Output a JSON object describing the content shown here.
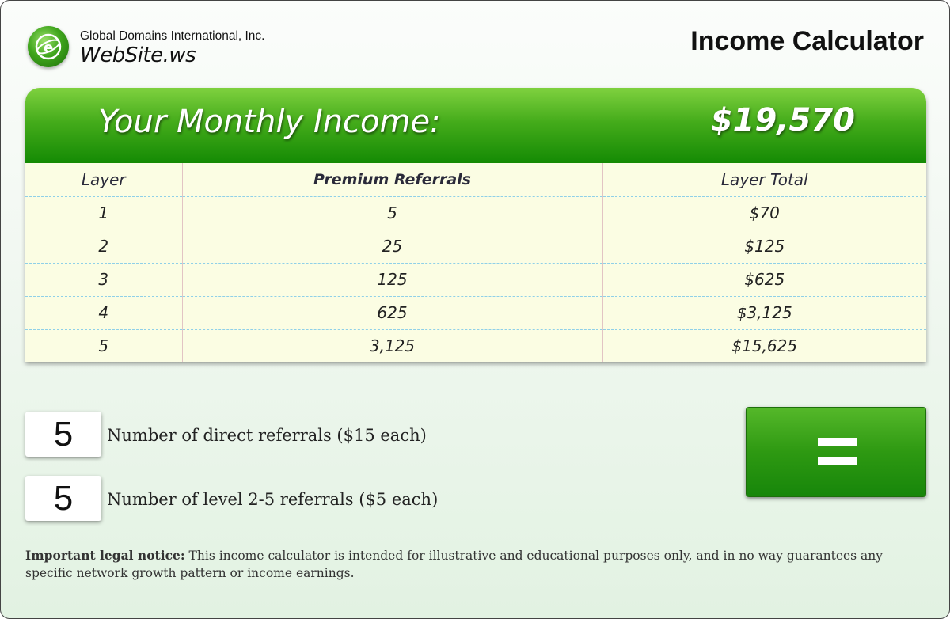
{
  "header": {
    "company": "Global Domains International, Inc.",
    "brand": "WebSite.ws",
    "title": "Income Calculator"
  },
  "income": {
    "label": "Your Monthly Income:",
    "value": "$19,570"
  },
  "table": {
    "headers": [
      "Layer",
      "Premium Referrals",
      "Layer Total"
    ],
    "rows": [
      [
        "1",
        "5",
        "$70"
      ],
      [
        "2",
        "25",
        "$125"
      ],
      [
        "3",
        "125",
        "$625"
      ],
      [
        "4",
        "625",
        "$3,125"
      ],
      [
        "5",
        "3,125",
        "$15,625"
      ]
    ]
  },
  "inputs": {
    "direct": {
      "value": "5",
      "label": "Number of direct referrals ($15 each)"
    },
    "level": {
      "value": "5",
      "label": "Number of level 2-5 referrals ($5 each)"
    }
  },
  "legal": {
    "title": "Important legal notice:",
    "text": " This income calculator is intended for illustrative and educational purposes only, and in no way guarantees any specific network growth pattern or income earnings."
  },
  "colors": {
    "accent_green": "#148a04",
    "header_green_light": "#7fd13f",
    "table_bg": "#fbfde3"
  },
  "icons": {
    "logo": "globe-e-icon",
    "calculate": "equals-icon"
  }
}
